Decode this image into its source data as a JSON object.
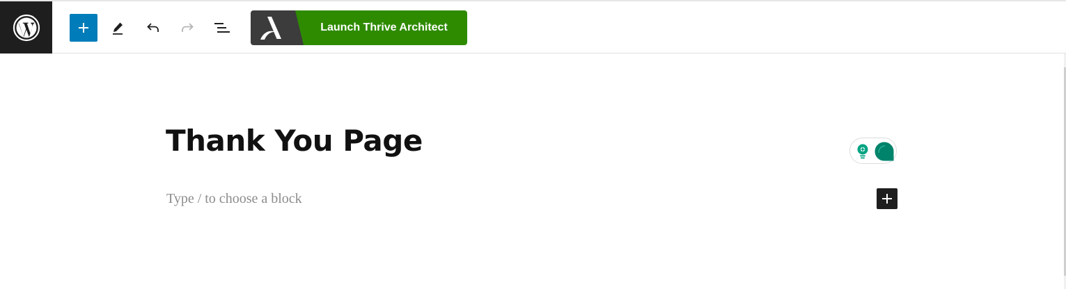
{
  "toolbar": {
    "wordpress_logo": "wordpress-logo-icon",
    "add_block_icon": "plus-icon",
    "tools_icon": "pencil-icon",
    "undo_icon": "undo-icon",
    "redo_icon": "redo-icon",
    "document_overview_icon": "list-view-icon",
    "thrive_button": {
      "logo_icon": "thrive-architect-logo-icon",
      "label": "Launch Thrive Architect"
    }
  },
  "editor": {
    "title": "Thank You Page",
    "block_placeholder": "Type / to choose a block",
    "grammar_widget": {
      "bulb_icon": "lightbulb-icon",
      "assistant_icon": "speech-bubble-icon"
    },
    "inline_add_icon": "plus-icon"
  },
  "colors": {
    "wp_dark": "#1e1e1e",
    "wp_blue": "#007cba",
    "thrive_green": "#2e8b00",
    "thrive_dark": "#3c3c3c",
    "widget_teal": "#00836b",
    "placeholder_gray": "#8c8c8c"
  }
}
